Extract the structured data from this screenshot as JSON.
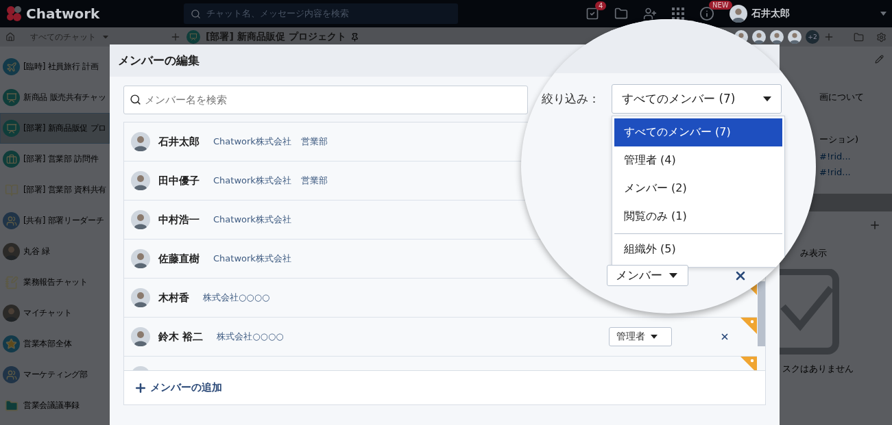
{
  "topbar": {
    "logo": "Chatwork",
    "search_placeholder": "チャット名、メッセージ内容を検索",
    "task_badge": "4",
    "info_badge": "NEW",
    "user_name": "石井太郎"
  },
  "subheader": {
    "filter": "すべてのチャット",
    "room_title": "[部署] 新商品販促 プロジェクト",
    "extra_members": "+2"
  },
  "sidebar": {
    "items": [
      {
        "name": "[臨時] 社員旅行 計画",
        "kind": "plane",
        "selected": false
      },
      {
        "name": "新商品 販売共有チャッ",
        "kind": "board",
        "selected": false
      },
      {
        "name": "[部署] 新商品販促 プロ",
        "kind": "board",
        "selected": true
      },
      {
        "name": "[部署] 営業部 訪問件",
        "kind": "bag",
        "selected": false
      },
      {
        "name": "[部署] 営業部 資料共有",
        "kind": "book",
        "selected": false
      },
      {
        "name": "[共有] 部署リーダーチ",
        "kind": "people",
        "selected": false
      },
      {
        "name": "丸谷 緑",
        "kind": "person",
        "selected": false
      },
      {
        "name": "業務報告チャット",
        "kind": "note",
        "selected": false
      },
      {
        "name": "マイチャット",
        "kind": "person",
        "selected": false
      },
      {
        "name": "営業本部全体",
        "kind": "star",
        "selected": false
      },
      {
        "name": "マーケティング部",
        "kind": "people",
        "selected": false
      },
      {
        "name": "営業会議議事録",
        "kind": "folder",
        "selected": false
      }
    ]
  },
  "right_panel": {
    "texts": [
      {
        "text": "画について",
        "kind": "text"
      },
      {
        "text": "ーション)",
        "kind": "text"
      },
      {
        "text": "#!rid...",
        "kind": "link"
      },
      {
        "text": "#!rid...",
        "kind": "link"
      }
    ],
    "task_filter": "み表示",
    "empty_message": "スクはありません"
  },
  "dialog": {
    "title": "メンバーの編集",
    "search_placeholder": "メンバー名を検索",
    "members": [
      {
        "name": "石井太郎",
        "company": "Chatwork株式会社",
        "department": "営業部",
        "external": false
      },
      {
        "name": "田中優子",
        "company": "Chatwork株式会社",
        "department": "営業部",
        "external": false
      },
      {
        "name": "中村浩一",
        "company": "Chatwork株式会社",
        "external": false
      },
      {
        "name": "佐藤直樹",
        "company": "Chatwork株式会社",
        "external": false
      },
      {
        "name": "木村香",
        "company": "株式会社○○○○",
        "external": true
      },
      {
        "name": "鈴木 裕二",
        "company": "株式会社○○○○",
        "role": "管理者",
        "external": true
      },
      {
        "external": true
      }
    ],
    "add_button": "メンバーの追加"
  },
  "filter": {
    "label": "絞り込み：",
    "value": "すべてのメンバー (7)",
    "options": [
      {
        "label": "すべてのメンバー (7)",
        "kind": "role",
        "selected": true
      },
      {
        "label": "管理者 (4)",
        "kind": "role",
        "selected": false
      },
      {
        "label": "メンバー (2)",
        "kind": "role",
        "selected": false
      },
      {
        "label": "閲覧のみ (1)",
        "kind": "role",
        "selected": false
      },
      {
        "label": "組織外 (5)",
        "kind": "scope",
        "selected": false
      }
    ],
    "row_role": "メンバー"
  }
}
